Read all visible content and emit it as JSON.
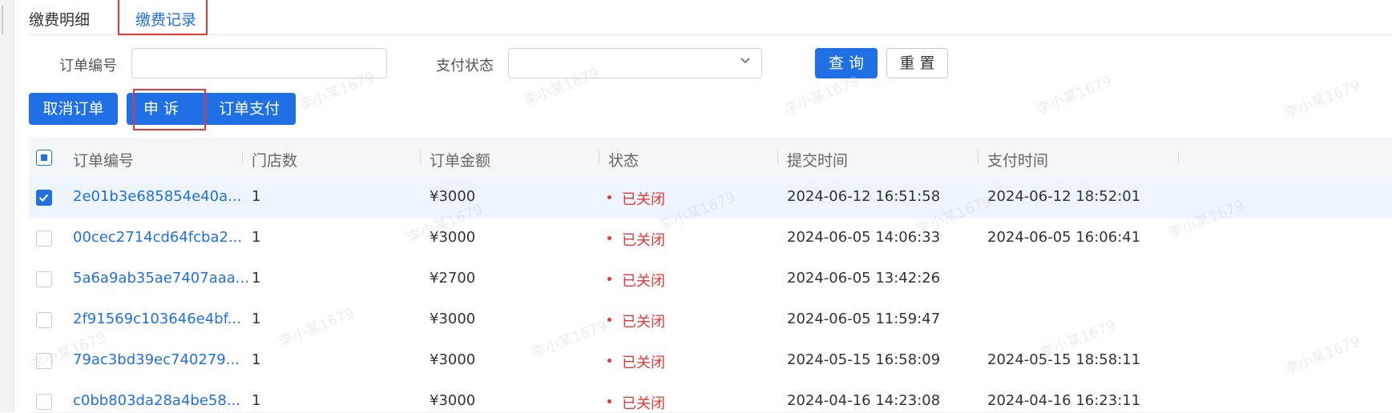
{
  "tabs": [
    {
      "label": "缴费明细",
      "active": false
    },
    {
      "label": "缴费记录",
      "active": true
    }
  ],
  "filters": {
    "order_no_label": "订单编号",
    "order_no_value": "",
    "pay_status_label": "支付状态",
    "pay_status_value": ""
  },
  "buttons": {
    "query": "查 询",
    "reset": "重 置",
    "cancel_order": "取消订单",
    "appeal": "申 诉",
    "pay_order": "订单支付"
  },
  "table": {
    "columns": [
      "订单编号",
      "门店数",
      "订单金额",
      "状态",
      "提交时间",
      "支付时间"
    ],
    "header_checkbox": "indeterminate",
    "rows": [
      {
        "selected": true,
        "order_no": "2e01b3e685854e40a...",
        "stores": "1",
        "amount": "¥3000",
        "status": "已关闭",
        "submit_time": "2024-06-12 16:51:58",
        "pay_time": "2024-06-12 18:52:01"
      },
      {
        "selected": false,
        "order_no": "00cec2714cd64fcba2...",
        "stores": "1",
        "amount": "¥3000",
        "status": "已关闭",
        "submit_time": "2024-06-05 14:06:33",
        "pay_time": "2024-06-05 16:06:41"
      },
      {
        "selected": false,
        "order_no": "5a6a9ab35ae7407aaa...",
        "stores": "1",
        "amount": "¥2700",
        "status": "已关闭",
        "submit_time": "2024-06-05 13:42:26",
        "pay_time": ""
      },
      {
        "selected": false,
        "order_no": "2f91569c103646e4bf...",
        "stores": "1",
        "amount": "¥3000",
        "status": "已关闭",
        "submit_time": "2024-06-05 11:59:47",
        "pay_time": ""
      },
      {
        "selected": false,
        "order_no": "79ac3bd39ec740279...",
        "stores": "1",
        "amount": "¥3000",
        "status": "已关闭",
        "submit_time": "2024-05-15 16:58:09",
        "pay_time": "2024-05-15 18:58:11"
      },
      {
        "selected": false,
        "order_no": "c0bb803da28a4be58...",
        "stores": "1",
        "amount": "¥3000",
        "status": "已关闭",
        "submit_time": "2024-04-16 14:23:08",
        "pay_time": "2024-04-16 16:23:11"
      }
    ]
  },
  "watermark": "李小某1679",
  "colors": {
    "primary": "#1f6fe5",
    "danger": "#e53935",
    "highlight_box": "#e53935"
  }
}
